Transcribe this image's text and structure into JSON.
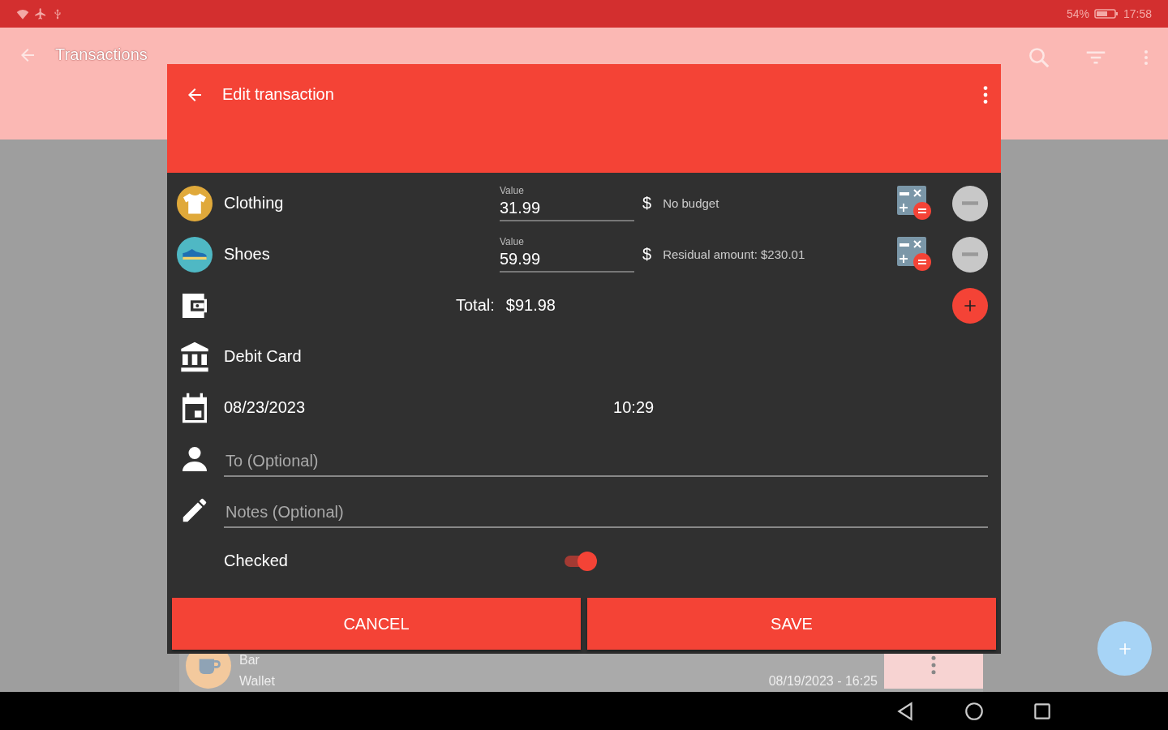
{
  "status_bar": {
    "battery": "54%",
    "time": "17:58"
  },
  "app_bar": {
    "title": "Transactions"
  },
  "dialog": {
    "title": "Edit transaction",
    "splits": [
      {
        "kind": "shirt",
        "category": "Clothing",
        "color": "#e0a93a",
        "value_label": "Value",
        "value": "31.99",
        "currency": "$",
        "budget": "No budget"
      },
      {
        "kind": "shoe",
        "category": "Shoes",
        "color": "#4fb8c4",
        "value_label": "Value",
        "value": "59.99",
        "currency": "$",
        "budget": "Residual amount: $230.01"
      }
    ],
    "total_label": "Total:",
    "total": "$91.98",
    "account": "Debit Card",
    "date": "08/23/2023",
    "time": "10:29",
    "payee": {
      "placeholder": "To (Optional)"
    },
    "notes": {
      "placeholder": "Notes (Optional)"
    },
    "checked": {
      "label": "Checked",
      "on": true
    },
    "buttons": [
      "CANCEL",
      "SAVE"
    ]
  },
  "background_item": {
    "name": "Bar",
    "account": "Wallet",
    "date": "08/19/2023 - 16:25"
  }
}
